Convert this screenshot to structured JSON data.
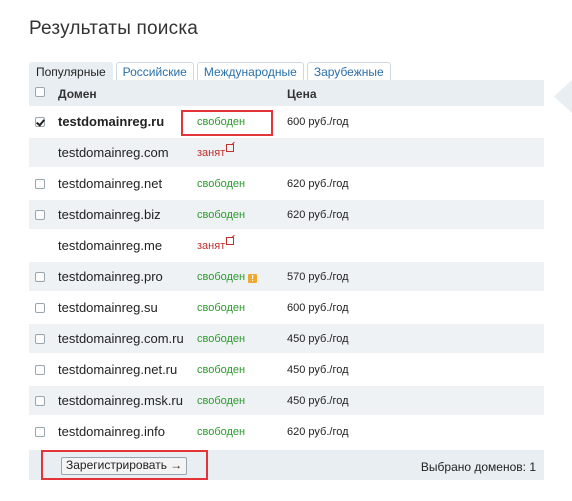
{
  "page_title": "Результаты поиска",
  "tabs": [
    {
      "label": "Популярные",
      "active": true
    },
    {
      "label": "Российские",
      "active": false
    },
    {
      "label": "Международные",
      "active": false
    },
    {
      "label": "Зарубежные",
      "active": false
    }
  ],
  "table": {
    "header": {
      "domain": "Домен",
      "price": "Цена"
    },
    "rows": [
      {
        "domain": "testdomainreg.ru",
        "status": "свободен",
        "price": "600 руб./год",
        "checked": true,
        "bold": true,
        "has_checkbox": true
      },
      {
        "domain": "testdomainreg.com",
        "status": "занят",
        "price": "",
        "checked": false,
        "has_checkbox": false,
        "link_icon": "external-link-icon"
      },
      {
        "domain": "testdomainreg.net",
        "status": "свободен",
        "price": "620 руб./год",
        "checked": false,
        "has_checkbox": true
      },
      {
        "domain": "testdomainreg.biz",
        "status": "свободен",
        "price": "620 руб./год",
        "checked": false,
        "has_checkbox": true
      },
      {
        "domain": "testdomainreg.me",
        "status": "занят",
        "price": "",
        "checked": false,
        "has_checkbox": false,
        "link_icon": "external-link-icon"
      },
      {
        "domain": "testdomainreg.pro",
        "status": "свободен",
        "price": "570 руб./год",
        "checked": false,
        "has_checkbox": true,
        "info_icon": "info-icon"
      },
      {
        "domain": "testdomainreg.su",
        "status": "свободен",
        "price": "600 руб./год",
        "checked": false,
        "has_checkbox": true
      },
      {
        "domain": "testdomainreg.com.ru",
        "status": "свободен",
        "price": "450 руб./год",
        "checked": false,
        "has_checkbox": true
      },
      {
        "domain": "testdomainreg.net.ru",
        "status": "свободен",
        "price": "450 руб./год",
        "checked": false,
        "has_checkbox": true
      },
      {
        "domain": "testdomainreg.msk.ru",
        "status": "свободен",
        "price": "450 руб./год",
        "checked": false,
        "has_checkbox": true
      },
      {
        "domain": "testdomainreg.info",
        "status": "свободен",
        "price": "620 руб./год",
        "checked": false,
        "has_checkbox": true
      }
    ]
  },
  "footer": {
    "register_label": "Зарегистрировать →",
    "selected_count": "Выбрано доменов: 1"
  },
  "colors": {
    "free": "#2c9a2c",
    "taken": "#c0302c",
    "highlight": "#e4343a",
    "header_bg": "#e8eef2"
  }
}
